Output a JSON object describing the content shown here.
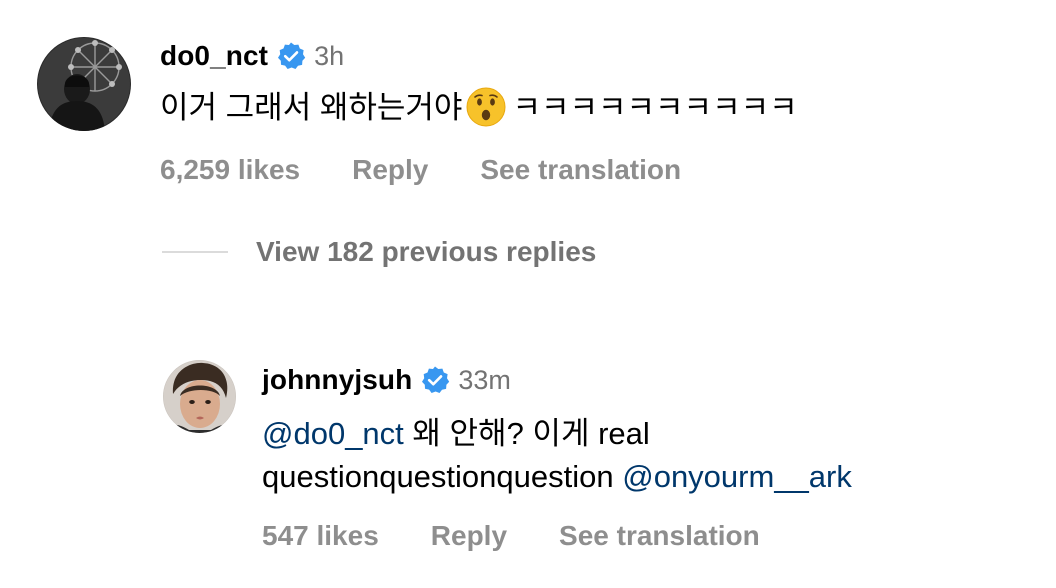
{
  "comments": [
    {
      "username": "do0_nct",
      "time": "3h",
      "text_before_emoji": "이거 그래서 왜하는거야",
      "emoji": "hushed-face-emoji",
      "text_after_emoji": "ㅋㅋㅋㅋㅋㅋㅋㅋㅋㅋ",
      "likes": "6,259 likes",
      "reply_label": "Reply",
      "translate_label": "See translation"
    }
  ],
  "view_replies_label": "View 182 previous replies",
  "reply": {
    "username": "johnnyjsuh",
    "time": "33m",
    "mention1": "@do0_nct",
    "text1": " 왜 안해? 이게 real",
    "text2": "questionquestionquestion ",
    "mention2": "@onyourm__ark",
    "likes": "547 likes",
    "reply_label": "Reply",
    "translate_label": "See translation"
  },
  "colors": {
    "verified": "#3897f0",
    "mention": "#00376b",
    "meta_gray": "#8e8e8e"
  },
  "icons": [
    "verified-badge-icon",
    "hushed-face-emoji"
  ]
}
